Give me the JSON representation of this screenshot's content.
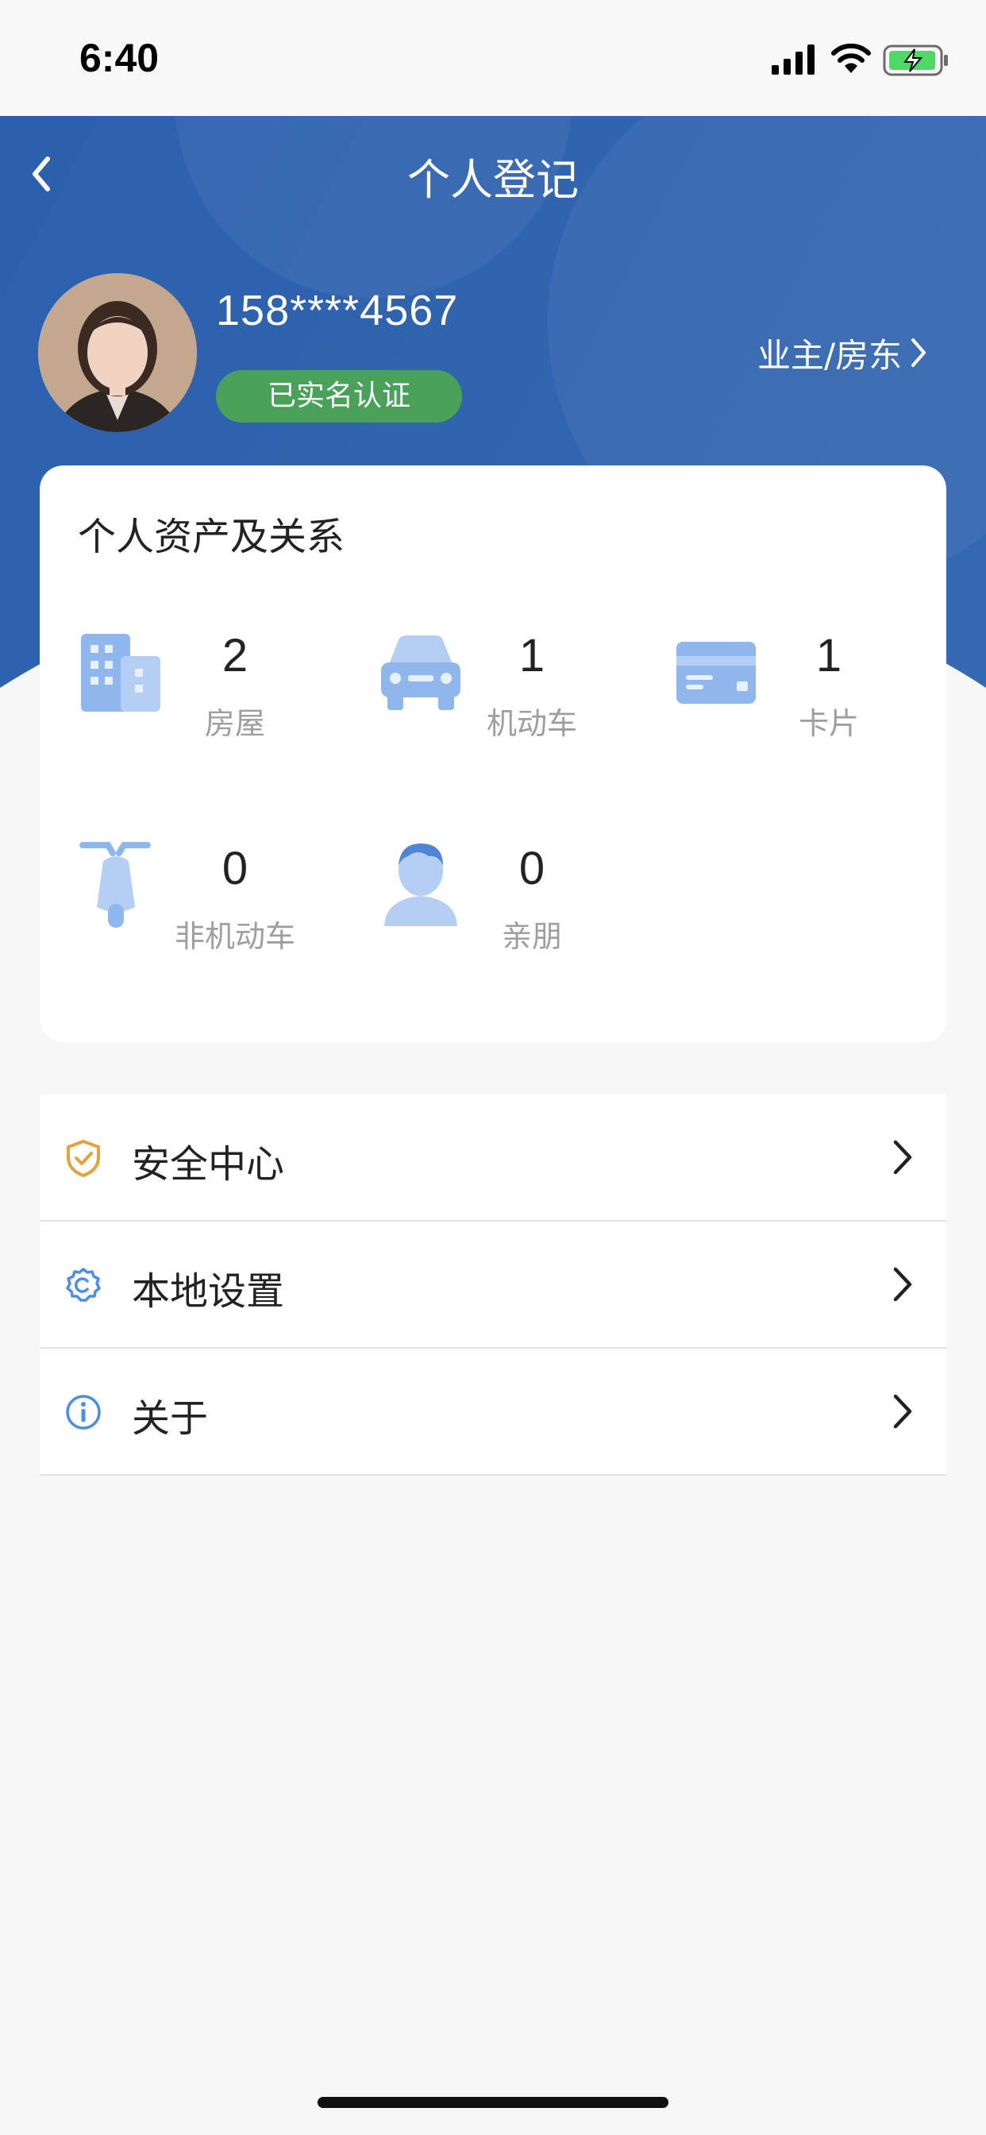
{
  "status_bar": {
    "time": "6:40"
  },
  "header": {
    "title": "个人登记",
    "phone": "158****4567",
    "verified_label": "已实名认证",
    "role_label": "业主/房东",
    "colors": {
      "primary": "#2f62ad",
      "verified": "#4aa25a"
    }
  },
  "assets": {
    "title": "个人资产及关系",
    "items": [
      {
        "icon": "building-icon",
        "value": "2",
        "label": "房屋"
      },
      {
        "icon": "car-icon",
        "value": "1",
        "label": "机动车"
      },
      {
        "icon": "card-icon",
        "value": "1",
        "label": "卡片"
      },
      {
        "icon": "scooter-icon",
        "value": "0",
        "label": "非机动车"
      },
      {
        "icon": "person-icon",
        "value": "0",
        "label": "亲朋"
      }
    ]
  },
  "menu": [
    {
      "icon": "shield-check-icon",
      "label": "安全中心",
      "icon_color": "#e4a23b"
    },
    {
      "icon": "gear-icon",
      "label": "本地设置",
      "icon_color": "#4a8ee8"
    },
    {
      "icon": "info-icon",
      "label": "关于",
      "icon_color": "#4a8ee8"
    }
  ]
}
